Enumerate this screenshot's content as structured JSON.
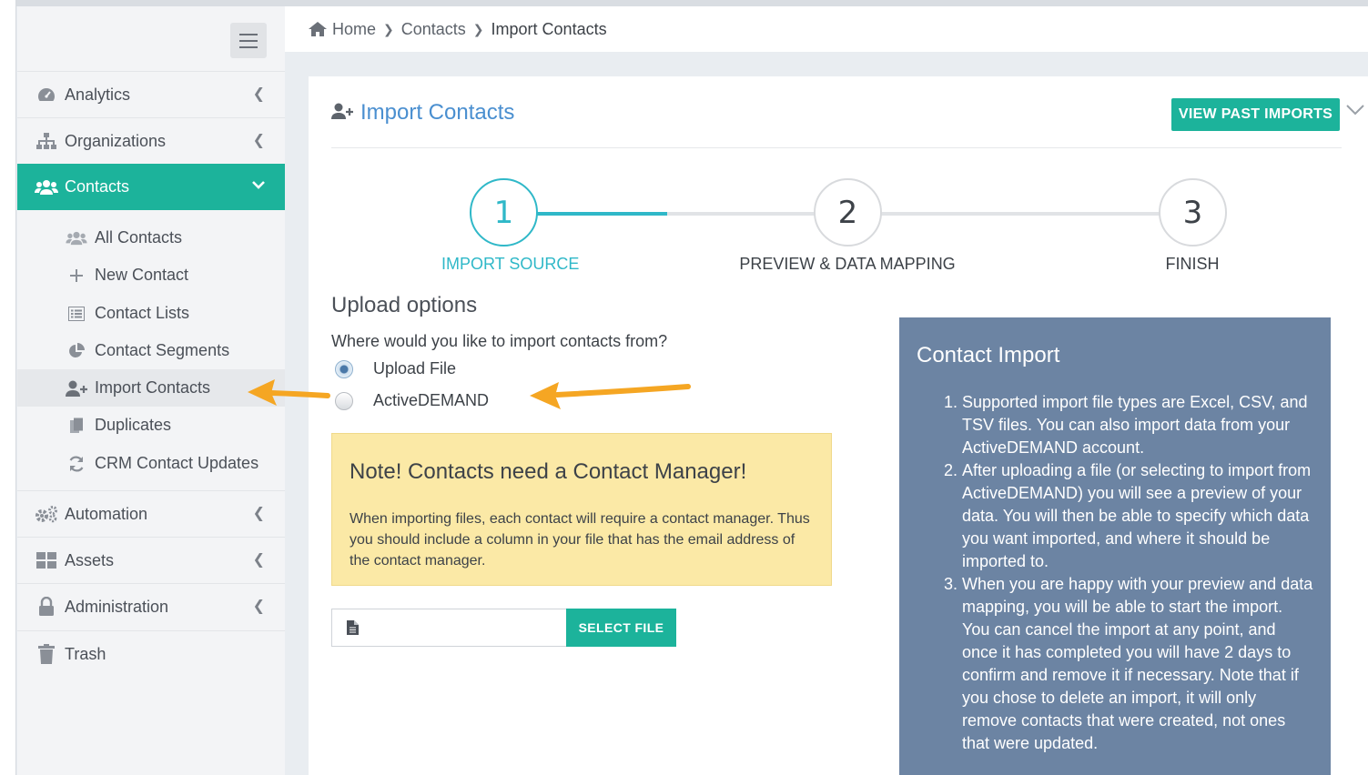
{
  "breadcrumb": {
    "home": "Home",
    "contacts": "Contacts",
    "current": "Import Contacts"
  },
  "sidebar": {
    "items": [
      {
        "label": "Analytics",
        "icon": "gauge-icon"
      },
      {
        "label": "Organizations",
        "icon": "sitemap-icon"
      },
      {
        "label": "Contacts",
        "icon": "users-icon",
        "active": true
      },
      {
        "label": "Automation",
        "icon": "gears-icon"
      },
      {
        "label": "Assets",
        "icon": "grid-icon"
      },
      {
        "label": "Administration",
        "icon": "lock-icon"
      },
      {
        "label": "Trash",
        "icon": "trash-icon"
      }
    ],
    "contacts_sub": [
      {
        "label": "All Contacts",
        "icon": "users-icon"
      },
      {
        "label": "New Contact",
        "icon": "plus-icon"
      },
      {
        "label": "Contact Lists",
        "icon": "list-icon"
      },
      {
        "label": "Contact Segments",
        "icon": "pie-chart-icon"
      },
      {
        "label": "Import Contacts",
        "icon": "user-plus-icon",
        "current": true
      },
      {
        "label": "Duplicates",
        "icon": "copy-icon"
      },
      {
        "label": "CRM Contact Updates",
        "icon": "refresh-icon"
      }
    ]
  },
  "page": {
    "title": "Import Contacts",
    "view_past_imports": "VIEW PAST IMPORTS"
  },
  "stepper": {
    "steps": [
      {
        "number": "1",
        "label": "IMPORT SOURCE",
        "active": true
      },
      {
        "number": "2",
        "label": "PREVIEW & DATA MAPPING"
      },
      {
        "number": "3",
        "label": "FINISH"
      }
    ],
    "progress": 0.4
  },
  "upload": {
    "heading": "Upload options",
    "question": "Where would you like to import contacts from?",
    "options": [
      {
        "label": "Upload File",
        "selected": true
      },
      {
        "label": "ActiveDEMAND",
        "selected": false
      }
    ]
  },
  "note": {
    "title": "Note! Contacts need a Contact Manager!",
    "body": "When importing files, each contact will require a contact manager. Thus you should include a column in your file that has the email address of the contact manager."
  },
  "file_input": {
    "value": "",
    "button": "SELECT FILE"
  },
  "info": {
    "title": "Contact Import",
    "items": [
      "Supported import file types are Excel, CSV, and TSV files. You can also import data from your ActiveDEMAND account.",
      "After uploading a file (or selecting to import from ActiveDEMAND) you will see a preview of your data. You will then be able to specify which data you want imported, and where it should be imported to.",
      "When you are happy with your preview and data mapping, you will be able to start the import. You can cancel the import at any point, and once it has completed you will have 2 days to confirm and remove it if necessary. Note that if you chose to delete an import, it will only remove contacts that were created, not ones that were updated."
    ]
  },
  "colors": {
    "accent": "#1cb39b",
    "step_active": "#2fb8c8",
    "title_blue": "#4a8fd0",
    "note_bg": "#fbe9a6",
    "info_bg": "#6c84a3",
    "arrow": "#f5a623"
  }
}
